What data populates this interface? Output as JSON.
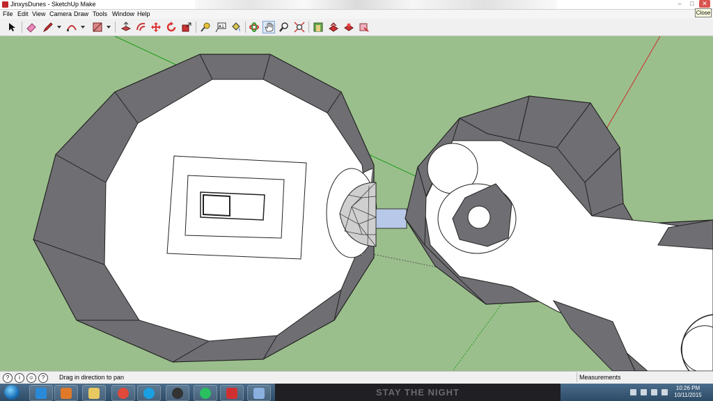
{
  "window": {
    "title": "JinxysDunes - SketchUp Make",
    "close_tooltip": "Close"
  },
  "menu": {
    "items": [
      "File",
      "Edit",
      "View",
      "Camera",
      "Draw",
      "Tools",
      "Window",
      "Help"
    ]
  },
  "toolbar": {
    "tools": [
      {
        "name": "select-tool",
        "icon": "arrow-icon"
      },
      {
        "name": "eraser-tool",
        "icon": "eraser-icon"
      },
      {
        "name": "line-tool",
        "icon": "pencil-icon"
      },
      {
        "name": "arc-tool",
        "icon": "arc-icon"
      },
      {
        "name": "rectangle-tool",
        "icon": "rectangle-icon"
      },
      {
        "name": "push-pull-tool",
        "icon": "push-pull-icon"
      },
      {
        "name": "offset-tool",
        "icon": "offset-icon"
      },
      {
        "name": "move-tool",
        "icon": "move-icon"
      },
      {
        "name": "rotate-tool",
        "icon": "rotate-icon"
      },
      {
        "name": "scale-tool",
        "icon": "scale-icon"
      },
      {
        "name": "tape-measure-tool",
        "icon": "tape-icon"
      },
      {
        "name": "text-tool",
        "icon": "text-icon"
      },
      {
        "name": "paint-bucket-tool",
        "icon": "paint-bucket-icon"
      },
      {
        "name": "orbit-tool",
        "icon": "orbit-icon"
      },
      {
        "name": "pan-tool",
        "icon": "hand-icon"
      },
      {
        "name": "zoom-tool",
        "icon": "magnifier-icon"
      },
      {
        "name": "zoom-extents-tool",
        "icon": "zoom-extents-icon"
      },
      {
        "name": "3d-warehouse",
        "icon": "warehouse-icon"
      },
      {
        "name": "share-model",
        "icon": "share-icon"
      },
      {
        "name": "extension-warehouse",
        "icon": "extension-icon"
      },
      {
        "name": "send-to-layout",
        "icon": "layout-icon"
      }
    ]
  },
  "status": {
    "text": "Drag in direction to pan",
    "measurements_label": "Measurements"
  },
  "taskbar": {
    "band_text": "STAY THE NIGHT",
    "time": "10:26 PM",
    "date": "10/11/2015"
  },
  "colors": {
    "viewport_bg": "#9bbf8c",
    "face_white": "#ffffff",
    "face_gray": "#6f6f73",
    "axis_red": "#cc2b2b",
    "axis_green": "#1a9a1a",
    "axis_blue": "#2b2bd0",
    "accent_selection": "#b8c8e8"
  }
}
